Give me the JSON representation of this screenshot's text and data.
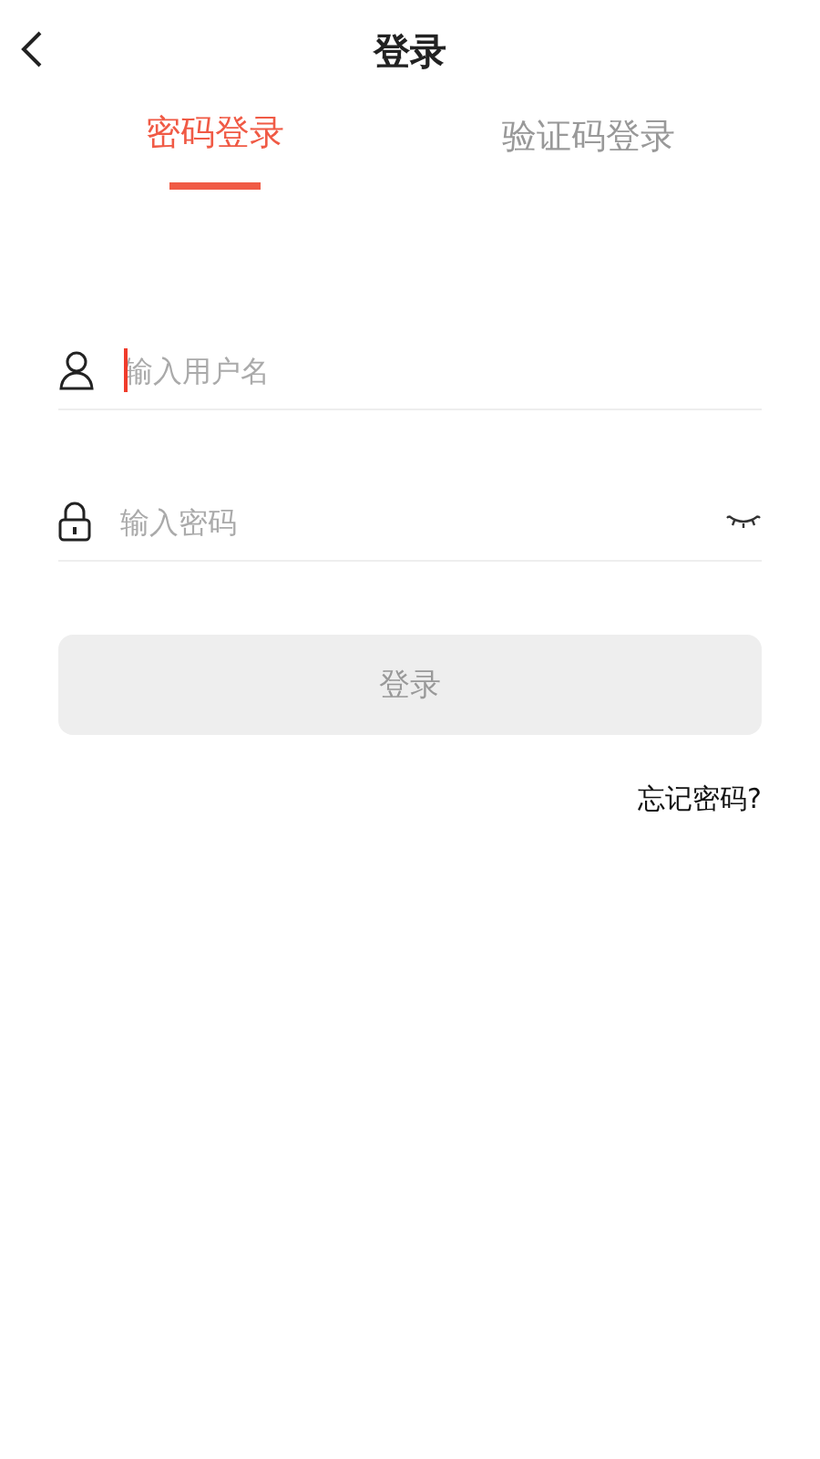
{
  "header": {
    "title": "登录"
  },
  "tabs": [
    {
      "label": "密码登录",
      "selected": true
    },
    {
      "label": "验证码登录",
      "selected": false
    }
  ],
  "fields": [
    {
      "kind": "username",
      "placeholder": "输入用户名",
      "focused": true
    },
    {
      "kind": "password",
      "placeholder": "输入密码",
      "focused": false
    }
  ],
  "login_button": {
    "label": "登录",
    "disabled": true
  },
  "forgot_link": "忘记密码?"
}
